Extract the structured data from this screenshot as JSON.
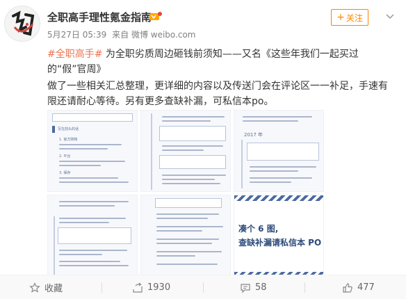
{
  "post": {
    "user_name": "全职高手理性氪金指南",
    "timestamp": "5月27日 05:39",
    "source": "来自 微博 weibo.com",
    "follow_label": "关注",
    "hashtag": "#全职高手#",
    "line1_rest": "为全职劣质周边砸钱前须知——又名《这些年我们一起买过的“假”官周》",
    "line2": "做了一些相关汇总整理，更详细的内容以及传送门会在评论区一一补足，手速有限还请耐心等待。另有更多查缺补漏，可私信本po。"
  },
  "thumbnails": {
    "headers": [
      "写在前头的话",
      "2017 年"
    ],
    "section_labels": [
      "1. 官方购物",
      "2. 平台",
      "3. 保存"
    ],
    "last_caption_line1": "凑个 6 图,",
    "last_caption_line2": "查缺补漏请私信本 PO"
  },
  "actions": {
    "favorite_label": "收藏",
    "repost_count": "1930",
    "comment_count": "58",
    "like_count": "477"
  },
  "colors": {
    "accent": "#ff8200",
    "hashtag": "#eb7350",
    "thumb_header": "#4a6aa0"
  },
  "icons": [
    "star-icon",
    "repost-icon",
    "comment-icon",
    "like-icon",
    "follow-plus-icon",
    "expand-chevron-icon",
    "vip-badge-icon"
  ]
}
